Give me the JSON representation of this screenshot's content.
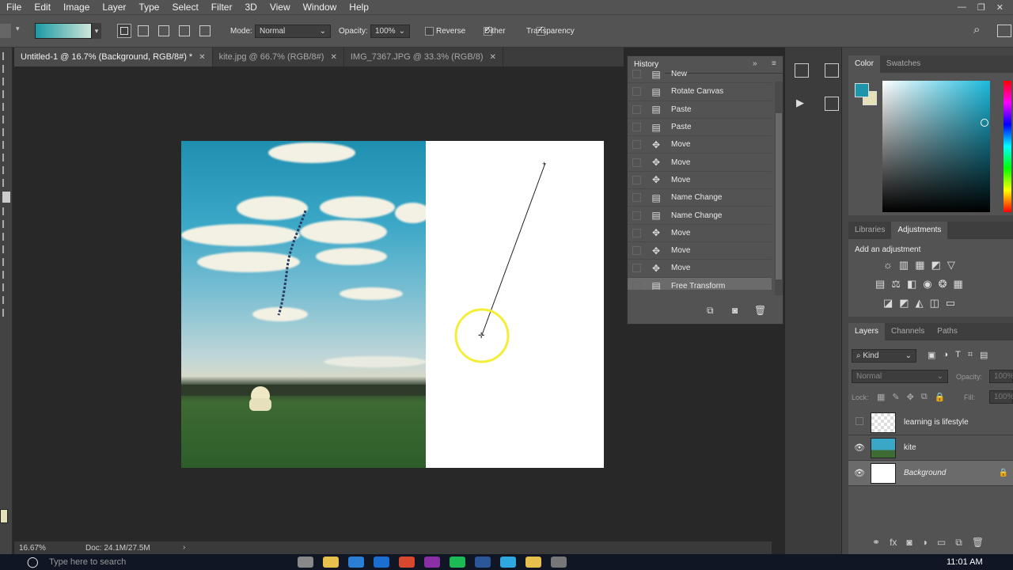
{
  "menubar": {
    "items": [
      "File",
      "Edit",
      "Image",
      "Layer",
      "Type",
      "Select",
      "Filter",
      "3D",
      "View",
      "Window",
      "Help"
    ]
  },
  "options": {
    "mode_label": "Mode:",
    "mode_value": "Normal",
    "opacity_label": "Opacity:",
    "opacity_value": "100%",
    "reverse_label": "Reverse",
    "dither_label": "Dither",
    "transparency_label": "Transparency",
    "reverse_checked": false,
    "dither_checked": true,
    "transparency_checked": true,
    "gradient_colors": [
      "#1a9aa6",
      "#cfe6d8"
    ]
  },
  "tabs": [
    {
      "label": "Untitled-1 @ 16.7% (Background, RGB/8#) *",
      "active": true
    },
    {
      "label": "kite.jpg @ 66.7% (RGB/8#)",
      "active": false
    },
    {
      "label": "IMG_7367.JPG @ 33.3% (RGB/8)",
      "active": false
    }
  ],
  "history": {
    "title": "History",
    "items": [
      {
        "label": "New",
        "icon": "doc"
      },
      {
        "label": "Rotate Canvas",
        "icon": "doc"
      },
      {
        "label": "Paste",
        "icon": "doc"
      },
      {
        "label": "Paste",
        "icon": "doc"
      },
      {
        "label": "Move",
        "icon": "move"
      },
      {
        "label": "Move",
        "icon": "move"
      },
      {
        "label": "Move",
        "icon": "move"
      },
      {
        "label": "Name Change",
        "icon": "doc"
      },
      {
        "label": "Name Change",
        "icon": "doc"
      },
      {
        "label": "Move",
        "icon": "move"
      },
      {
        "label": "Move",
        "icon": "move"
      },
      {
        "label": "Move",
        "icon": "move"
      },
      {
        "label": "Free Transform",
        "icon": "doc",
        "selected": true
      }
    ]
  },
  "color_panel": {
    "tab_color": "Color",
    "tab_swatches": "Swatches",
    "foreground": "#1e95a8",
    "background": "#e6e0b8"
  },
  "adjustments": {
    "tab_libraries": "Libraries",
    "tab_adjustments": "Adjustments",
    "heading": "Add an adjustment"
  },
  "layers_panel": {
    "tab_layers": "Layers",
    "tab_channels": "Channels",
    "tab_paths": "Paths",
    "kind_label": "Kind",
    "blend_mode": "Normal",
    "opacity_label": "Opacity:",
    "opacity_value": "100%",
    "lock_label": "Lock:",
    "fill_label": "Fill:",
    "fill_value": "100%",
    "layers": [
      {
        "name": "learning is lifestyle",
        "visible": false
      },
      {
        "name": "kite",
        "visible": true
      },
      {
        "name": "Background",
        "visible": true,
        "locked": true
      }
    ]
  },
  "status": {
    "zoom": "16.67%",
    "doc": "Doc: 24.1M/27.5M"
  },
  "taskbar": {
    "search_placeholder": "Type here to search",
    "time": "11:01 AM"
  }
}
